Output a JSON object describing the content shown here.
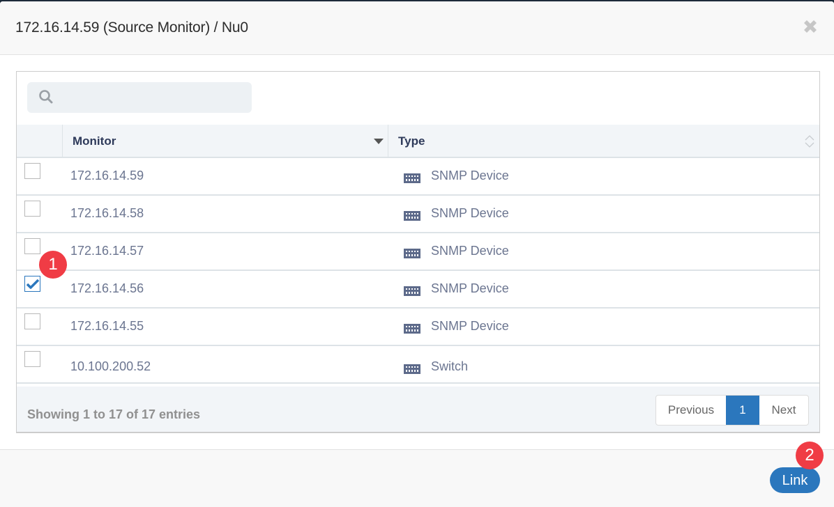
{
  "modal": {
    "title": "172.16.14.59 (Source Monitor) / Nu0",
    "close_icon": "close-icon"
  },
  "search": {
    "value": "",
    "placeholder": "",
    "icon": "search-icon"
  },
  "table": {
    "columns": [
      {
        "label": "Monitor",
        "sort": "descending"
      },
      {
        "label": "Type",
        "sort": "none"
      }
    ],
    "rows": [
      {
        "monitor": "172.16.14.59",
        "type": "SNMP Device",
        "type_icon": "network-device-icon",
        "checked": false
      },
      {
        "monitor": "172.16.14.58",
        "type": "SNMP Device",
        "type_icon": "network-device-icon",
        "checked": false
      },
      {
        "monitor": "172.16.14.57",
        "type": "SNMP Device",
        "type_icon": "network-device-icon",
        "checked": false
      },
      {
        "monitor": "172.16.14.56",
        "type": "SNMP Device",
        "type_icon": "network-device-icon",
        "checked": true
      },
      {
        "monitor": "172.16.14.55",
        "type": "SNMP Device",
        "type_icon": "network-device-icon",
        "checked": false
      },
      {
        "monitor": "10.100.200.52",
        "type": "Switch",
        "type_icon": "network-device-icon",
        "checked": false
      }
    ]
  },
  "footer": {
    "entries_info": "Showing 1 to 17 of 17 entries",
    "pagination": {
      "previous": "Previous",
      "current": "1",
      "next": "Next"
    }
  },
  "actions": {
    "link_label": "Link"
  },
  "annotations": {
    "step1": "1",
    "step2": "2"
  },
  "colors": {
    "accent": "#2b77bd",
    "badge": "#f03c45",
    "header_text": "#2e3a5a",
    "cell_text": "#6b7590"
  }
}
